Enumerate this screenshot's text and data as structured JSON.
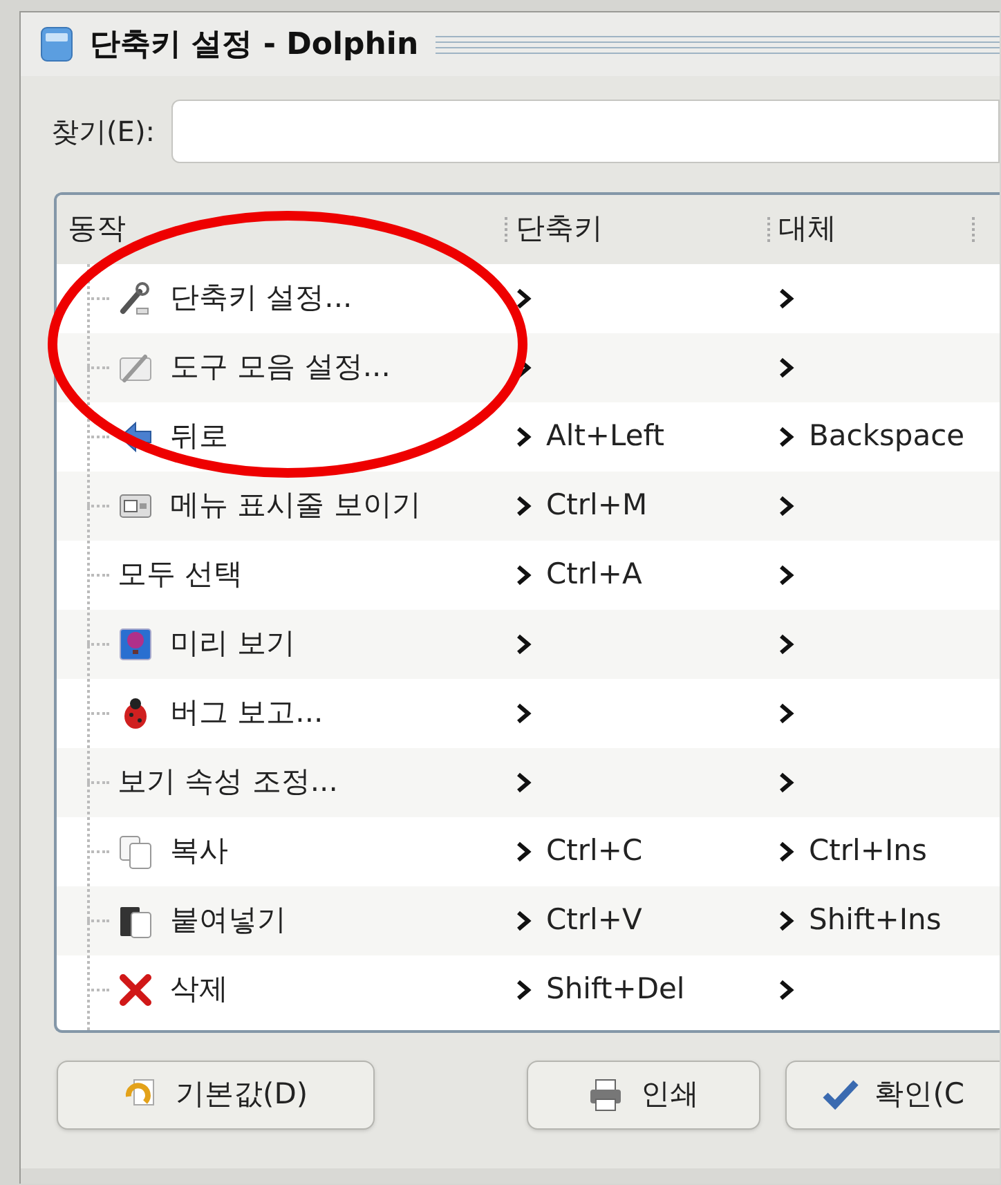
{
  "window": {
    "title": "단축키 설정 - Dolphin"
  },
  "search": {
    "label": "찾기(E):"
  },
  "table": {
    "columns": [
      "동작",
      "단축키",
      "대체"
    ],
    "rows": [
      {
        "action": "단축키 설정..."
      },
      {
        "action": "도구 모음 설정..."
      },
      {
        "action": "뒤로",
        "shortcut": "Alt+Left",
        "alternate": "Backspace"
      },
      {
        "action": "메뉴 표시줄 보이기",
        "shortcut": "Ctrl+M"
      },
      {
        "action": "모두 선택",
        "shortcut": "Ctrl+A"
      },
      {
        "action": "미리 보기"
      },
      {
        "action": "버그 보고..."
      },
      {
        "action": "보기 속성 조정..."
      },
      {
        "action": "복사",
        "shortcut": "Ctrl+C",
        "alternate": "Ctrl+Ins"
      },
      {
        "action": "붙여넣기",
        "shortcut": "Ctrl+V",
        "alternate": "Shift+Ins"
      },
      {
        "action": "삭제",
        "shortcut": "Shift+Del"
      }
    ]
  },
  "buttons": [
    "기본값(D)",
    "인쇄",
    "확인(C"
  ],
  "annotation": {
    "kind": "ellipse",
    "color": "#ee0000"
  }
}
